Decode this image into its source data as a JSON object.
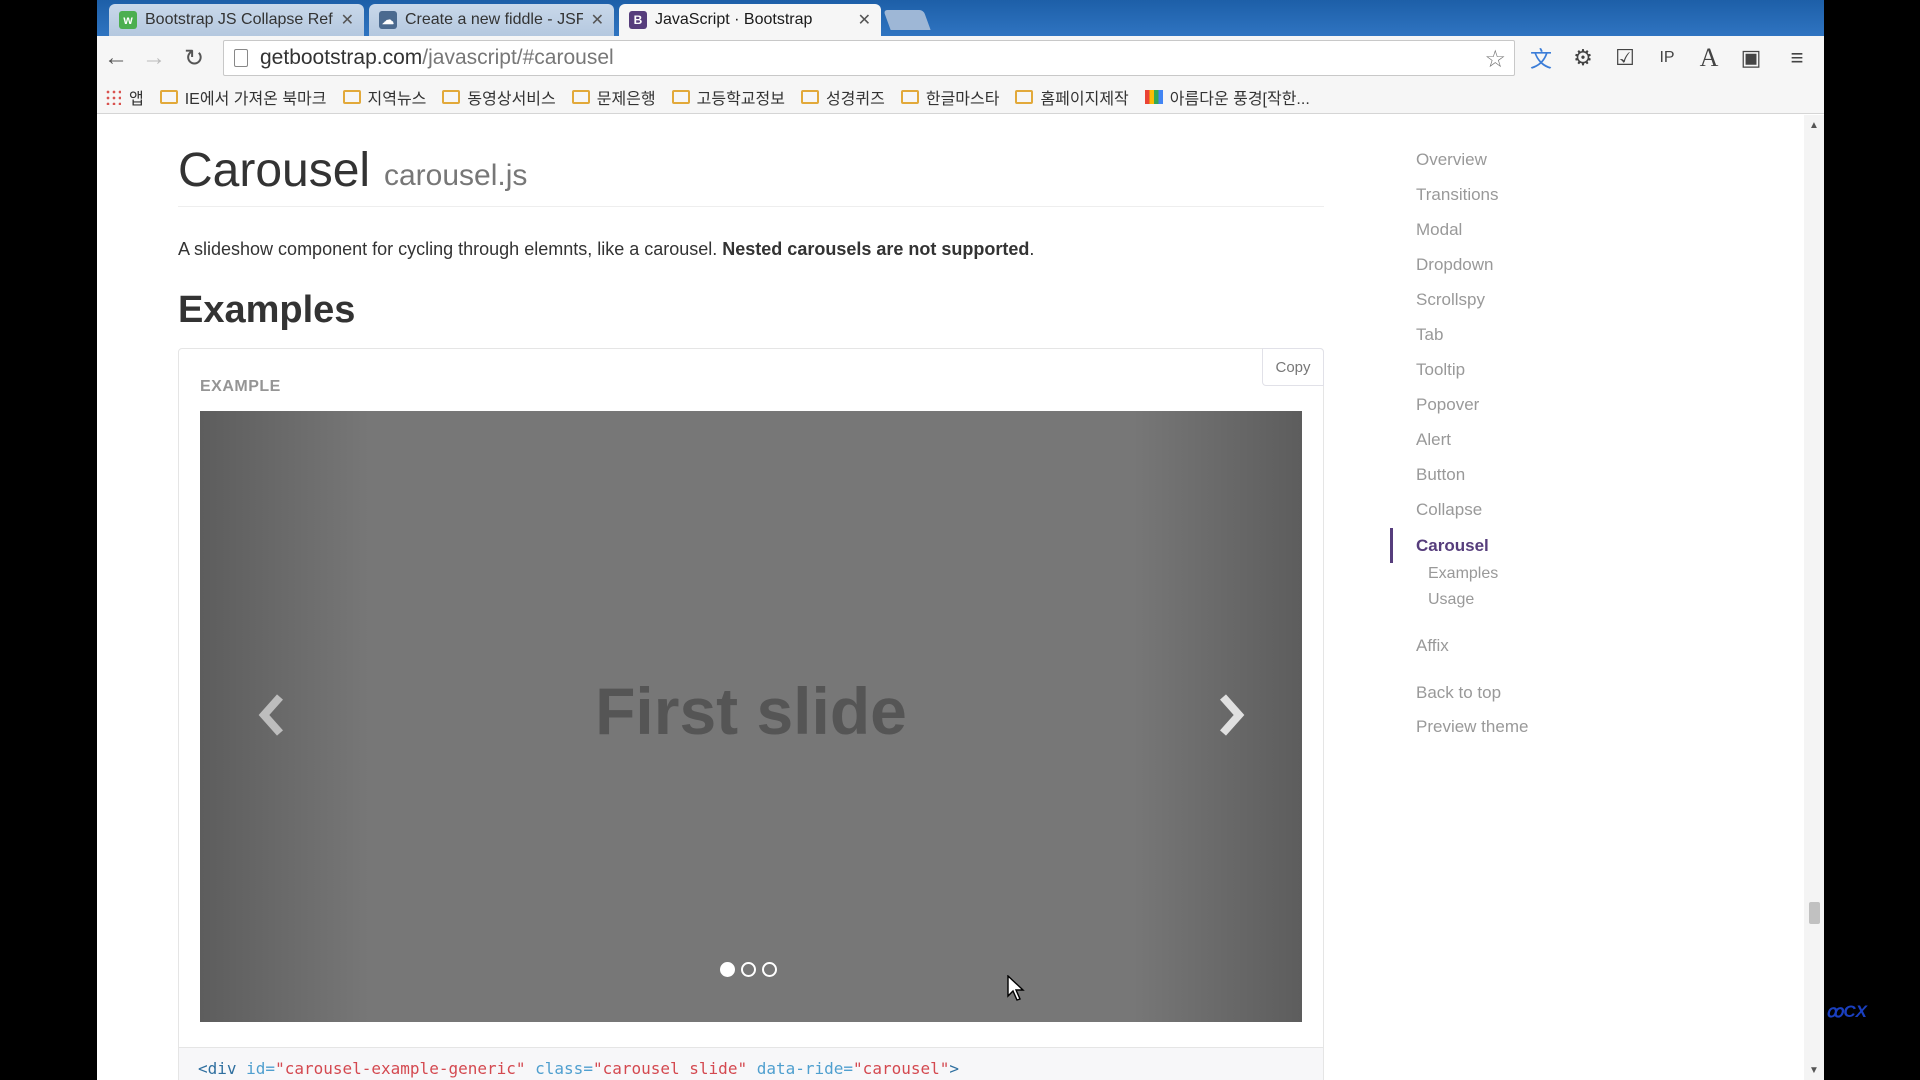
{
  "browser": {
    "tabs": [
      {
        "label": "Bootstrap JS Collapse Ref",
        "icon": "w3schools-icon",
        "active": false
      },
      {
        "label": "Create a new fiddle - JSFi",
        "icon": "jsfiddle-cloud-icon",
        "active": false
      },
      {
        "label": "JavaScript · Bootstrap",
        "icon": "bootstrap-b-icon",
        "active": true
      }
    ],
    "url_host": "getbootstrap.com",
    "url_path": "/javascript/#carousel",
    "bookmarks": [
      {
        "label": "앱",
        "icon": "apps-grid-icon"
      },
      {
        "label": "IE에서 가져온 북마크",
        "icon": "folder-icon"
      },
      {
        "label": "지역뉴스",
        "icon": "folder-icon"
      },
      {
        "label": "동영상서비스",
        "icon": "folder-icon"
      },
      {
        "label": "문제은행",
        "icon": "folder-icon"
      },
      {
        "label": "고등학교정보",
        "icon": "folder-icon"
      },
      {
        "label": "성경퀴즈",
        "icon": "folder-icon"
      },
      {
        "label": "한글마스타",
        "icon": "folder-icon"
      },
      {
        "label": "홈페이지제작",
        "icon": "folder-icon"
      },
      {
        "label": "아름다운 풍경[작한...",
        "icon": "google-colors-icon"
      }
    ]
  },
  "page": {
    "title": "Carousel",
    "subtitle": "carousel.js",
    "lead_text": "A slideshow component for cycling through elemnts, like a carousel. ",
    "lead_bold": "Nested carousels are not supported",
    "lead_end": ".",
    "examples_heading": "Examples",
    "example_label": "EXAMPLE",
    "copy_label": "Copy",
    "slide_caption": "First slide",
    "indicator_count": 3,
    "active_indicator": 0,
    "code": {
      "open": "<div",
      "attr1": " id=",
      "val1": "\"carousel-example-generic\"",
      "attr2": " class=",
      "val2": "\"carousel slide\"",
      "attr3": " data-ride=",
      "val3": "\"carousel\"",
      "close": ">"
    }
  },
  "sidebar": {
    "items": [
      "Overview",
      "Transitions",
      "Modal",
      "Dropdown",
      "Scrollspy",
      "Tab",
      "Tooltip",
      "Popover",
      "Alert",
      "Button",
      "Collapse"
    ],
    "active": "Carousel",
    "sub_items": [
      "Examples",
      "Usage"
    ],
    "after": [
      "Affix"
    ],
    "footer": [
      "Back to top",
      "Preview theme"
    ]
  },
  "colors": {
    "accent": "#563d7c",
    "carousel_bg": "#777777"
  }
}
